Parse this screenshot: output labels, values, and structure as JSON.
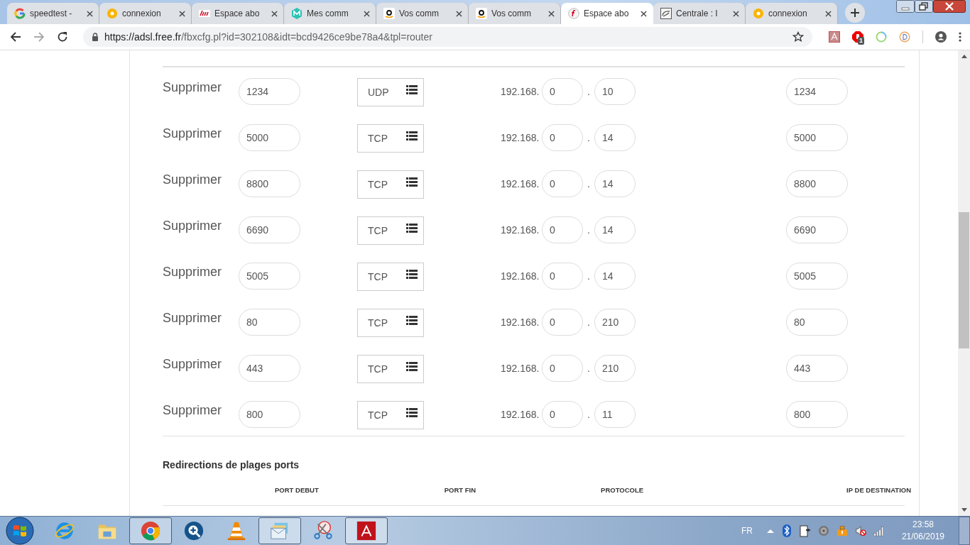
{
  "browser": {
    "tabs": [
      {
        "title": "speedtest -",
        "kind": "google",
        "selected": false
      },
      {
        "title": "connexion",
        "kind": "ring",
        "selected": false
      },
      {
        "title": "Espace abo",
        "kind": "free",
        "selected": false
      },
      {
        "title": "Mes comm",
        "kind": "m",
        "selected": false
      },
      {
        "title": "Vos comm",
        "kind": "amazon",
        "selected": false
      },
      {
        "title": "Vos comm",
        "kind": "amazon",
        "selected": false
      },
      {
        "title": "Espace abo",
        "kind": "f",
        "selected": true
      },
      {
        "title": "Centrale : I",
        "kind": "phone",
        "selected": false
      },
      {
        "title": "connexion",
        "kind": "ring",
        "selected": false
      }
    ],
    "url_host": "https://adsl.free.fr",
    "url_path": "/fbxcfg.pl?id=302108&idt=bcd9426ce9be78a4&tpl=router",
    "extension_badge": "1"
  },
  "redirections": {
    "rows": [
      {
        "delete_label": "Supprimer",
        "port": "1234",
        "protocol": "UDP",
        "ip_prefix": "192.168.",
        "ip_3": "0",
        "ip_dot": ".",
        "ip_4": "10",
        "dest_port": "1234"
      },
      {
        "delete_label": "Supprimer",
        "port": "5000",
        "protocol": "TCP",
        "ip_prefix": "192.168.",
        "ip_3": "0",
        "ip_dot": ".",
        "ip_4": "14",
        "dest_port": "5000"
      },
      {
        "delete_label": "Supprimer",
        "port": "8800",
        "protocol": "TCP",
        "ip_prefix": "192.168.",
        "ip_3": "0",
        "ip_dot": ".",
        "ip_4": "14",
        "dest_port": "8800"
      },
      {
        "delete_label": "Supprimer",
        "port": "6690",
        "protocol": "TCP",
        "ip_prefix": "192.168.",
        "ip_3": "0",
        "ip_dot": ".",
        "ip_4": "14",
        "dest_port": "6690"
      },
      {
        "delete_label": "Supprimer",
        "port": "5005",
        "protocol": "TCP",
        "ip_prefix": "192.168.",
        "ip_3": "0",
        "ip_dot": ".",
        "ip_4": "14",
        "dest_port": "5005"
      },
      {
        "delete_label": "Supprimer",
        "port": "80",
        "protocol": "TCP",
        "ip_prefix": "192.168.",
        "ip_3": "0",
        "ip_dot": ".",
        "ip_4": "210",
        "dest_port": "80"
      },
      {
        "delete_label": "Supprimer",
        "port": "443",
        "protocol": "TCP",
        "ip_prefix": "192.168.",
        "ip_3": "0",
        "ip_dot": ".",
        "ip_4": "210",
        "dest_port": "443"
      },
      {
        "delete_label": "Supprimer",
        "port": "800",
        "protocol": "TCP",
        "ip_prefix": "192.168.",
        "ip_3": "0",
        "ip_dot": ".",
        "ip_4": "11",
        "dest_port": "800"
      }
    ]
  },
  "range_redirections": {
    "title": "Redirections de plages ports",
    "columns": [
      "PORT DEBUT",
      "PORT FIN",
      "PROTOCOLE",
      "IP DE DESTINATION"
    ]
  },
  "taskbar": {
    "apps": [
      {
        "kind": "ie",
        "selected": false
      },
      {
        "kind": "folder",
        "selected": false
      },
      {
        "kind": "chrome",
        "selected": true
      },
      {
        "kind": "magnifier",
        "selected": false
      },
      {
        "kind": "vlc",
        "selected": false
      },
      {
        "kind": "mail",
        "selected": true
      },
      {
        "kind": "scissors",
        "selected": false
      },
      {
        "kind": "acrobat",
        "selected": true
      }
    ],
    "language": "FR",
    "time": "23:58",
    "date": "21/06/2019"
  }
}
